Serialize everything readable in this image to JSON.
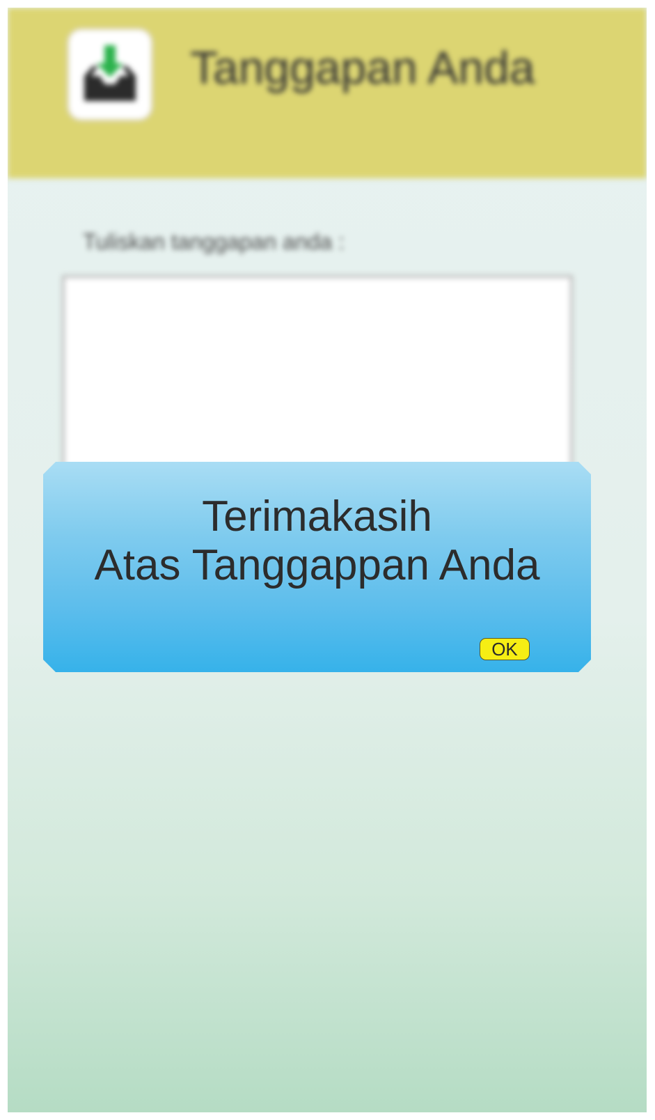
{
  "header": {
    "title": "Tanggapan Anda",
    "icon": "inbox-download-icon",
    "background_color": "#dcd572"
  },
  "form": {
    "prompt_label": "Tuliskan tanggapan anda :",
    "textarea_value": ""
  },
  "dialog": {
    "line1": "Terimakasih",
    "line2": "Atas Tanggappan Anda",
    "ok_label": "OK",
    "ok_color": "#f6ee14",
    "background_color": "#5cbdec"
  }
}
